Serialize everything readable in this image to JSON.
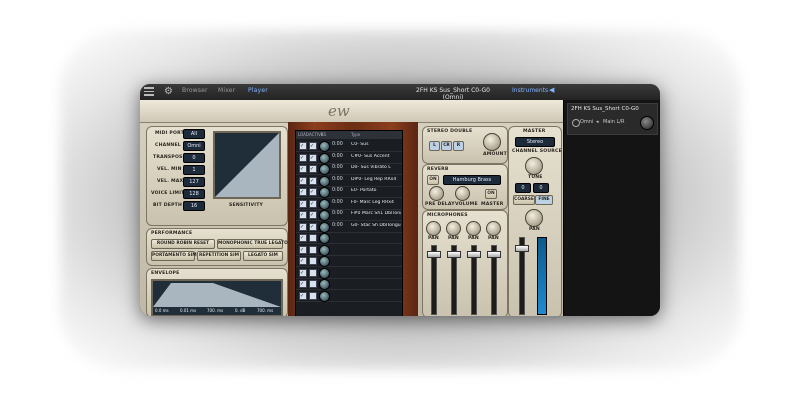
{
  "topbar": {
    "tabs": [
      "Browser",
      "Mixer",
      "Player"
    ],
    "active_tab": "Player",
    "current_instrument": "2FH KS Sus_Short C0-G0 (Omni)",
    "instruments_label": "Instruments"
  },
  "side_panel": {
    "instrument_name": "2FH KS Sus_Short C0-G0",
    "channel": "Omni",
    "output": "Main L/R"
  },
  "left_panel": {
    "midi_port_label": "MIDI PORT",
    "midi_port_value": "All",
    "channel_label": "CHANNEL",
    "channel_value": "Omni",
    "transpose_label": "TRANSPOSE",
    "transpose_value": "0",
    "vel_min_label": "VEL. MIN",
    "vel_min_value": "1",
    "vel_max_label": "VEL. MAX",
    "vel_max_value": "127",
    "voice_limit_label": "VOICE LIMIT",
    "voice_limit_value": "128",
    "bit_depth_label": "BIT DEPTH",
    "bit_depth_value": "16",
    "sensitivity_label": "SENSITIVITY"
  },
  "performance": {
    "title": "PERFORMANCE",
    "buttons": [
      "ROUND ROBIN RESET",
      "MONOPHONIC TRUE LEGATO",
      "PORTAMENTO SIM",
      "REPETITION SIM",
      "LEGATO SIM"
    ]
  },
  "envelope": {
    "title": "ENVELOPE",
    "values": [
      "0.0 ms",
      "0.01 ms",
      "700. ms",
      "0. dB",
      "700. ms"
    ]
  },
  "articulations": {
    "header": [
      "LOAD",
      "ACTIVE",
      "KS",
      "Type"
    ],
    "rows": [
      {
        "ms": "0:00",
        "name": "C0- Sus"
      },
      {
        "ms": "0:00",
        "name": "C#0- Sus Accent"
      },
      {
        "ms": "0:00",
        "name": "D0- Sus Vibrato L"
      },
      {
        "ms": "0:00",
        "name": "D#0- Leg Rep RRx4"
      },
      {
        "ms": "0:00",
        "name": "E0- Portato"
      },
      {
        "ms": "0:00",
        "name": "F0- Marc Leg RRx4"
      },
      {
        "ms": "0:00",
        "name": "F#0 Marc Sh1 DblTongueRRx2"
      },
      {
        "ms": "0:00",
        "name": "G0- Stac Sh DblTongueRRx2"
      }
    ],
    "empty_rows": 6
  },
  "stereo_double": {
    "title": "STEREO DOUBLE",
    "buttons": [
      "L",
      "CR",
      "R"
    ],
    "knob_label": "AMOUNT"
  },
  "reverb": {
    "title": "REVERB",
    "on_label": "ON",
    "preset": "Hamburg Brass",
    "on2_label": "ON",
    "knobs": [
      "PRE DELAY",
      "VOLUME",
      "MASTER"
    ]
  },
  "microphones": {
    "title": "MICROPHONES",
    "knobs": [
      "PAN",
      "PAN",
      "PAN",
      "PAN"
    ]
  },
  "master": {
    "title": "MASTER",
    "mode": "Stereo",
    "channel_source_label": "CHANNEL SOURCE",
    "tune_label": "TUNE",
    "tune_values": [
      "0",
      "0"
    ],
    "coarse_label": "COARSE",
    "fine_label": "FINE",
    "pan_label": "PAN"
  }
}
